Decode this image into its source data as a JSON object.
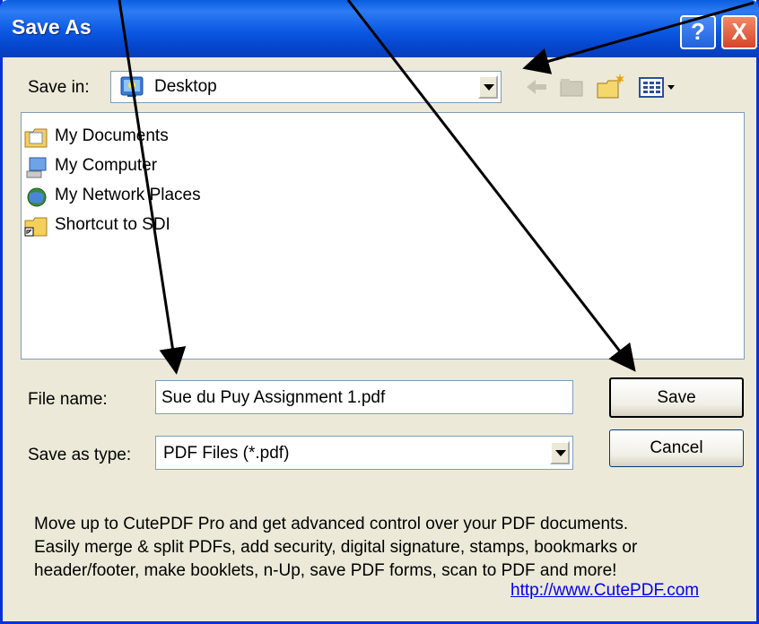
{
  "window": {
    "title": "Save As",
    "help_label": "?",
    "close_label": "X"
  },
  "toolbar": {
    "save_in_label": "Save in:",
    "save_in_value": "Desktop",
    "icons": [
      "back-icon",
      "up-folder-icon",
      "new-folder-icon",
      "view-menu-icon"
    ]
  },
  "files": [
    {
      "name": "My Documents",
      "icon": "my-documents-icon"
    },
    {
      "name": "My Computer",
      "icon": "my-computer-icon"
    },
    {
      "name": "My Network Places",
      "icon": "network-places-icon"
    },
    {
      "name": "Shortcut to SDI",
      "icon": "shortcut-folder-icon"
    }
  ],
  "form": {
    "file_name_label": "File name:",
    "file_name_value": "Sue du Puy Assignment 1.pdf",
    "save_type_label": "Save as type:",
    "save_type_value": "PDF Files (*.pdf)"
  },
  "buttons": {
    "save": "Save",
    "cancel": "Cancel"
  },
  "promo": {
    "lines": [
      "Move up to CutePDF Pro and get advanced control over your PDF documents.",
      "Easily merge & split PDFs, add security, digital signature, stamps, bookmarks or",
      "header/footer, make booklets, n-Up, save PDF forms, scan to PDF and more!"
    ],
    "link": "http://www.CutePDF.com"
  },
  "colors": {
    "titlebar": "#0a5ee0",
    "dialog_bg": "#ece9d8",
    "link": "#0000ee",
    "annotation_arrow": "#000000"
  }
}
